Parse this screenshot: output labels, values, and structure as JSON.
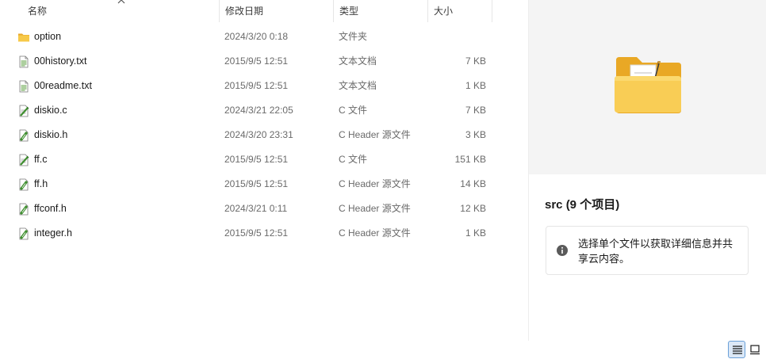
{
  "columns": {
    "name": "名称",
    "modified": "修改日期",
    "type": "类型",
    "size": "大小"
  },
  "files": [
    {
      "name": "option",
      "modified": "2024/3/20 0:18",
      "type": "文件夹",
      "size": "",
      "icon": "folder-icon"
    },
    {
      "name": "00history.txt",
      "modified": "2015/9/5 12:51",
      "type": "文本文档",
      "size": "7 KB",
      "icon": "text-file-icon"
    },
    {
      "name": "00readme.txt",
      "modified": "2015/9/5 12:51",
      "type": "文本文档",
      "size": "1 KB",
      "icon": "text-file-icon"
    },
    {
      "name": "diskio.c",
      "modified": "2024/3/21 22:05",
      "type": "C 文件",
      "size": "7 KB",
      "icon": "c-source-file-icon"
    },
    {
      "name": "diskio.h",
      "modified": "2024/3/20 23:31",
      "type": "C Header 源文件",
      "size": "3 KB",
      "icon": "c-header-file-icon"
    },
    {
      "name": "ff.c",
      "modified": "2015/9/5 12:51",
      "type": "C 文件",
      "size": "151 KB",
      "icon": "c-source-file-icon"
    },
    {
      "name": "ff.h",
      "modified": "2015/9/5 12:51",
      "type": "C Header 源文件",
      "size": "14 KB",
      "icon": "c-header-file-icon"
    },
    {
      "name": "ffconf.h",
      "modified": "2024/3/21 0:11",
      "type": "C Header 源文件",
      "size": "12 KB",
      "icon": "c-header-file-icon"
    },
    {
      "name": "integer.h",
      "modified": "2015/9/5 12:51",
      "type": "C Header 源文件",
      "size": "1 KB",
      "icon": "c-header-file-icon"
    }
  ],
  "details": {
    "title": "src (9 个项目)",
    "info": "选择单个文件以获取详细信息并共享云内容。",
    "preview_icon": "folder-icon"
  },
  "statusbar": {
    "views": [
      "details-view-icon",
      "large-icons-view-icon"
    ],
    "active_view": "details-view-icon"
  },
  "colors": {
    "folder": "#f5c342",
    "header_icon": "#3f8f2f",
    "selected_view": "#dbe8f7"
  }
}
